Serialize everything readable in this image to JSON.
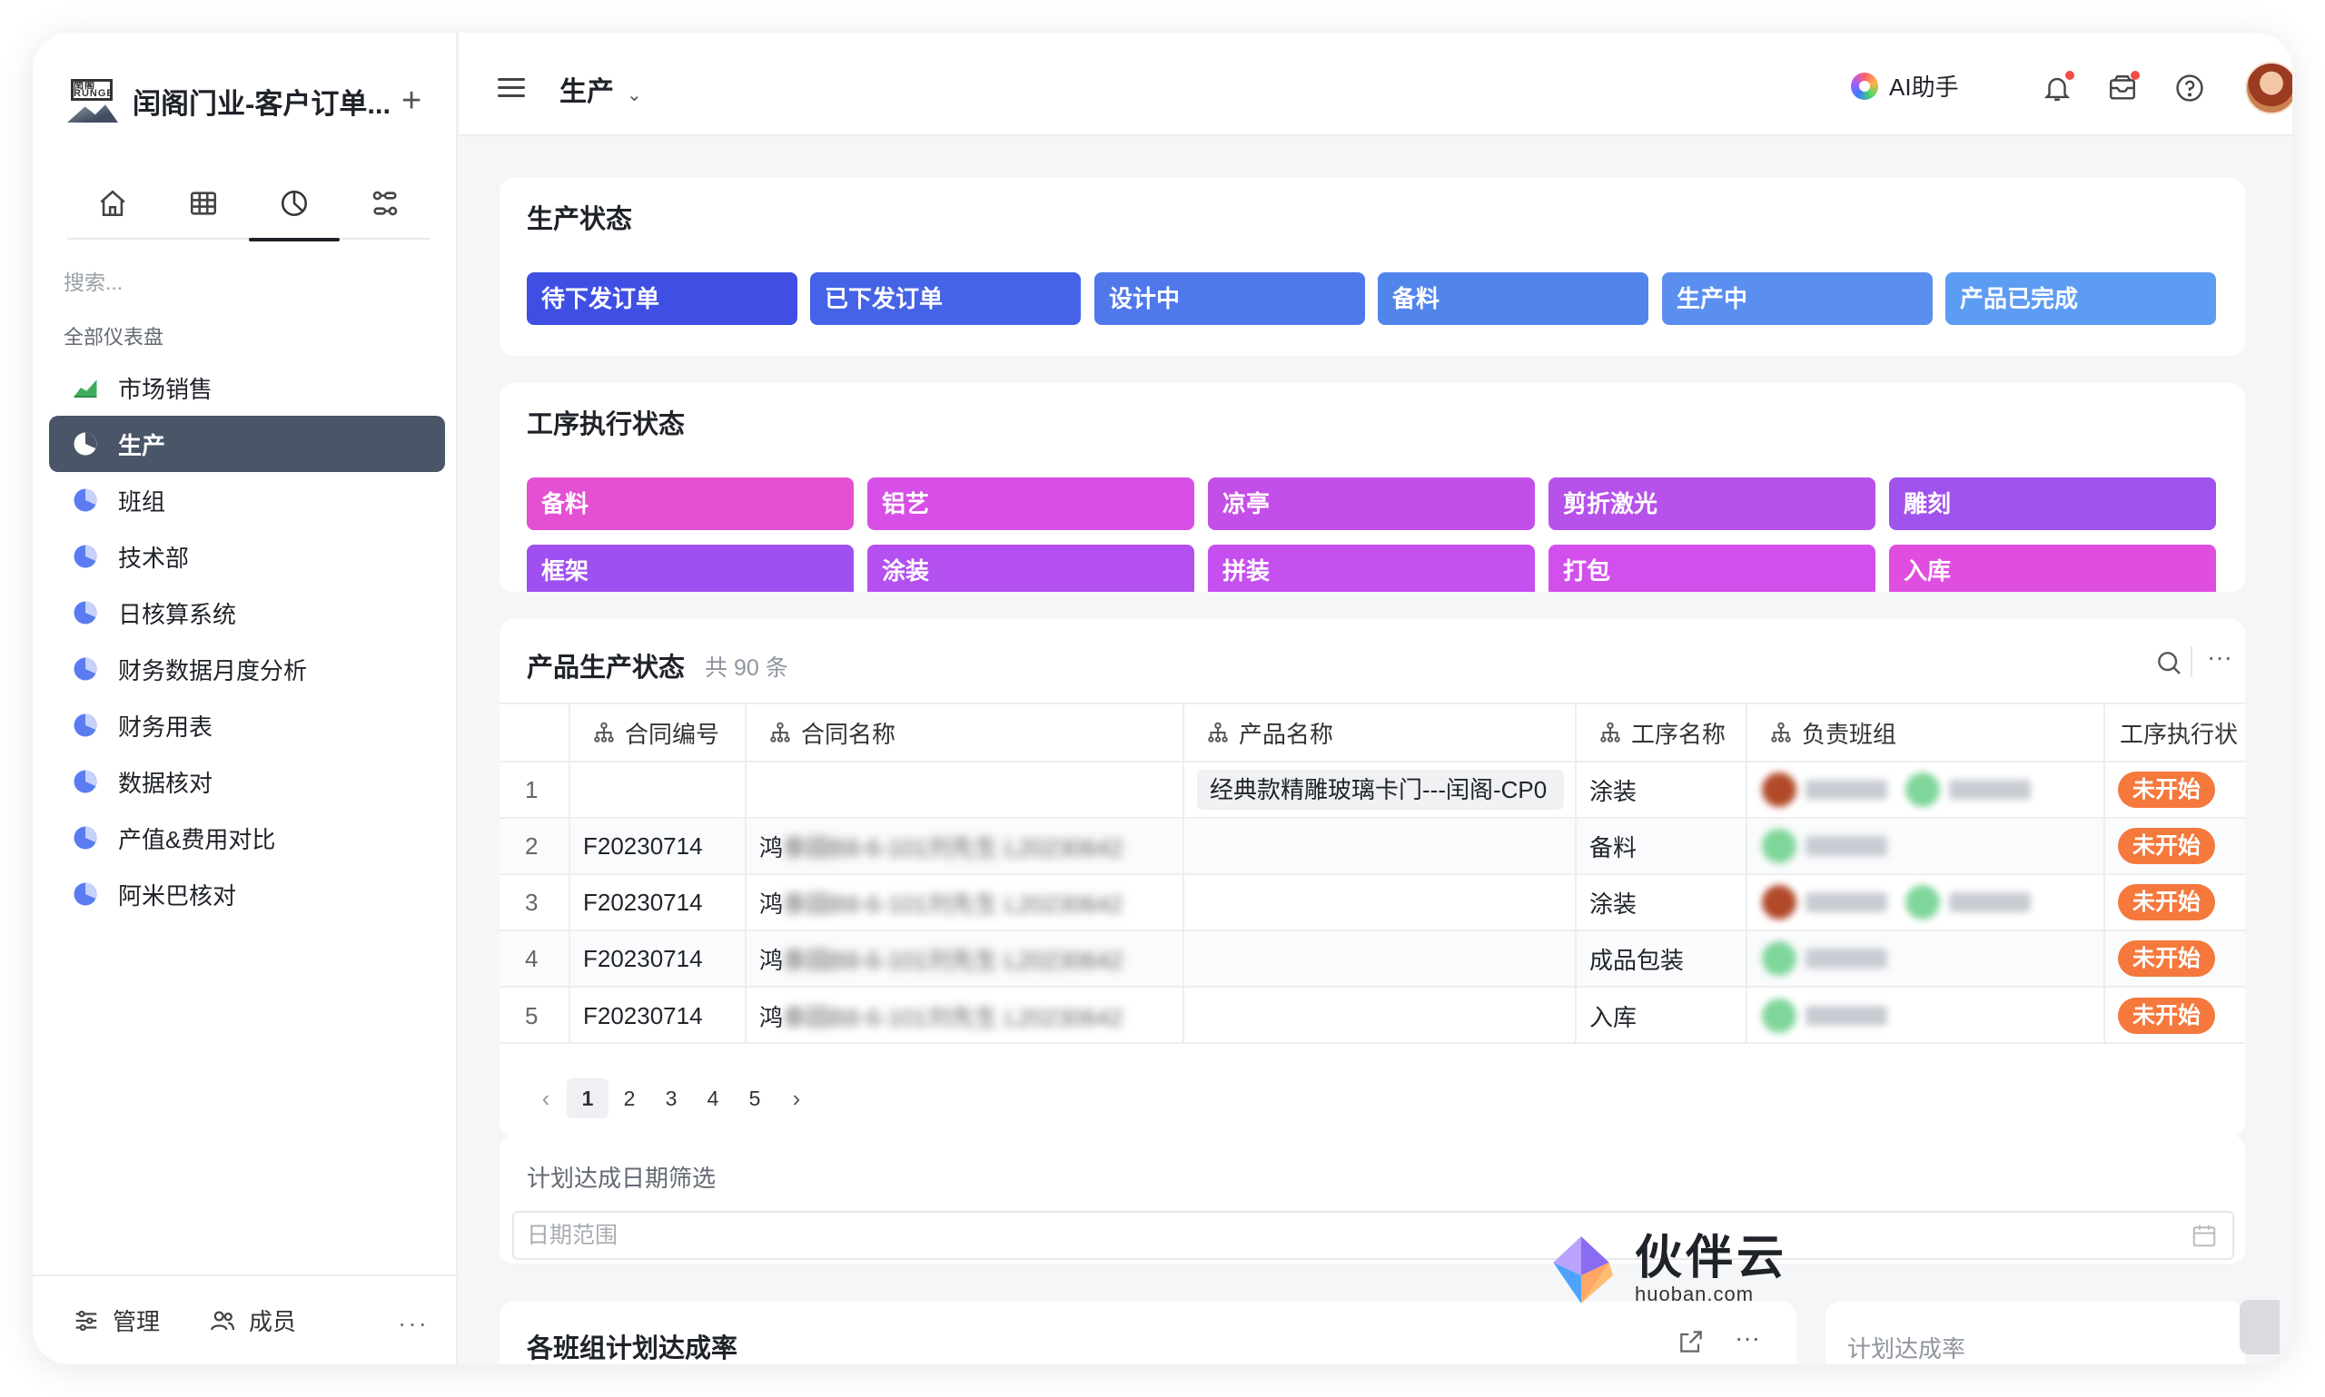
{
  "app": {
    "title": "闰阁门业-客户订单..."
  },
  "sidebar": {
    "search_placeholder": "搜索...",
    "section_label": "全部仪表盘",
    "items": [
      {
        "label": "市场销售",
        "icon": "area-chart-icon"
      },
      {
        "label": "生产",
        "icon": "pie-chart-icon",
        "active": true
      },
      {
        "label": "班组",
        "icon": "pie-chart-icon"
      },
      {
        "label": "技术部",
        "icon": "pie-chart-icon"
      },
      {
        "label": "日核算系统",
        "icon": "pie-chart-icon"
      },
      {
        "label": "财务数据月度分析",
        "icon": "pie-chart-icon"
      },
      {
        "label": "财务用表",
        "icon": "pie-chart-icon"
      },
      {
        "label": "数据核对",
        "icon": "pie-chart-icon"
      },
      {
        "label": "产值&费用对比",
        "icon": "pie-chart-icon"
      },
      {
        "label": "阿米巴核对",
        "icon": "pie-chart-icon"
      }
    ],
    "footer": {
      "manage": "管理",
      "members": "成员",
      "more": "···"
    }
  },
  "header": {
    "page_title": "生产",
    "ai_label": "AI助手"
  },
  "production_status": {
    "title": "生产状态",
    "chips": [
      {
        "label": "待下发订单",
        "color": "#3f4fe3"
      },
      {
        "label": "已下发订单",
        "color": "#4563e6"
      },
      {
        "label": "设计中",
        "color": "#4f78ea"
      },
      {
        "label": "备料",
        "color": "#5285ec"
      },
      {
        "label": "生产中",
        "color": "#5a8ff0"
      },
      {
        "label": "产品已完成",
        "color": "#5c9cf2"
      }
    ]
  },
  "process_status": {
    "title": "工序执行状态",
    "chips": [
      {
        "label": "备料",
        "color": "#e350d2"
      },
      {
        "label": "铝艺",
        "color": "#d74fe6"
      },
      {
        "label": "凉亭",
        "color": "#c44fe8"
      },
      {
        "label": "剪折激光",
        "color": "#b651ea"
      },
      {
        "label": "雕刻",
        "color": "#a052ec"
      },
      {
        "label": "框架",
        "color": "#a04ff0"
      },
      {
        "label": "涂装",
        "color": "#b44ff0"
      },
      {
        "label": "拼装",
        "color": "#c64ff0"
      },
      {
        "label": "打包",
        "color": "#d24fec"
      },
      {
        "label": "入库",
        "color": "#e04ee0"
      }
    ]
  },
  "product_table": {
    "title": "产品生产状态",
    "count": "共 90 条",
    "columns": [
      "合同编号",
      "合同名称",
      "产品名称",
      "工序名称",
      "负责班组",
      "工序执行状"
    ],
    "rows": [
      {
        "idx": "1",
        "contract_no": "",
        "contract_name": "",
        "product": "经典款精雕玻璃卡门---闰阁-CP0",
        "process": "涂装",
        "status": "未开始"
      },
      {
        "idx": "2",
        "contract_no": "F20230714",
        "contract_name": "鸿",
        "contract_blur": "泰园B8-6-101刘先生 L20230642",
        "product": "",
        "process": "备料",
        "status": "未开始"
      },
      {
        "idx": "3",
        "contract_no": "F20230714",
        "contract_name": "鸿",
        "contract_blur": "泰园B8-6-101刘先生 L20230642",
        "product": "",
        "process": "涂装",
        "status": "未开始"
      },
      {
        "idx": "4",
        "contract_no": "F20230714",
        "contract_name": "鸿",
        "contract_blur": "泰园B8-6-101刘先生 L20230642",
        "product": "",
        "process": "成品包装",
        "status": "未开始"
      },
      {
        "idx": "5",
        "contract_no": "F20230714",
        "contract_name": "鸿",
        "contract_blur": "泰园B8-6-101刘先生 L20230642",
        "product": "",
        "process": "入库",
        "status": "未开始"
      }
    ],
    "pages": [
      "1",
      "2",
      "3",
      "4",
      "5"
    ],
    "current_page": "1"
  },
  "date_filter": {
    "title": "计划达成日期筛选",
    "placeholder": "日期范围"
  },
  "team_rate": {
    "title": "各班组计划达成率"
  },
  "plan_rate": {
    "title": "计划达成率"
  },
  "watermark": {
    "name": "伙伴云",
    "url": "huoban.com"
  }
}
